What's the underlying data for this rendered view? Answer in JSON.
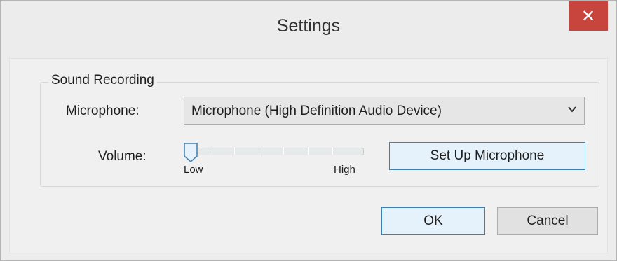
{
  "window": {
    "title": "Settings",
    "close_glyph": "✕"
  },
  "sound_recording": {
    "group_label": "Sound Recording",
    "microphone_label": "Microphone:",
    "microphone_selected": "Microphone (High Definition Audio Device)",
    "volume_label": "Volume:",
    "volume_low": "Low",
    "volume_high": "High",
    "volume_level": 0,
    "setup_button": "Set Up Microphone"
  },
  "dialog_buttons": {
    "ok": "OK",
    "cancel": "Cancel"
  },
  "colors": {
    "close_button": "#c7453d",
    "accent_border": "#3c7fb1",
    "accent_fill": "#e5f1fb"
  },
  "icons": {
    "close": "close-icon",
    "dropdown": "chevron-down-icon",
    "slider_thumb": "slider-thumb"
  }
}
